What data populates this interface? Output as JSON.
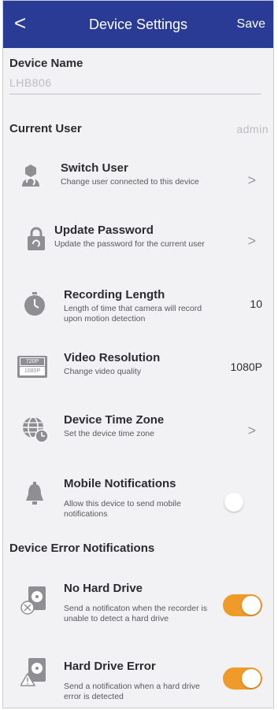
{
  "header": {
    "back_label": "<",
    "title": "Device Settings",
    "save_label": "Save",
    "bg_color": "#2a3b95"
  },
  "device_name": {
    "label": "Device Name",
    "value": "LHB806"
  },
  "current_user": {
    "label": "Current User",
    "value": "admin"
  },
  "items": [
    {
      "title": "Switch User",
      "desc": "Change user connected to this device",
      "icon": "user-switch-icon",
      "trailing": ">"
    },
    {
      "title": "Update Password",
      "desc": "Update the password for the current user",
      "icon": "lock-refresh-icon",
      "trailing": ">"
    },
    {
      "title": "Recording Length",
      "desc": "Length of time that camera will record upon motion detection",
      "icon": "stopwatch-icon",
      "trailing": "10"
    },
    {
      "title": "Video Resolution",
      "desc": "Change video quality",
      "icon": "resolution-icon",
      "trailing": "1080P",
      "icon_text_top": "720P",
      "icon_text_bottom": "1080P"
    },
    {
      "title": "Device Time Zone",
      "desc": "Set the device time zone",
      "icon": "globe-clock-icon",
      "trailing": ">"
    },
    {
      "title": "Mobile Notifications",
      "desc": "Allow this device to send mobile notifications",
      "icon": "bell-icon",
      "toggle": false
    }
  ],
  "error_section": {
    "label": "Device Error Notifications",
    "items": [
      {
        "title": "No Hard Drive",
        "desc": "Send a notificaton when the recorder is unable to detect a hard drive",
        "icon": "hard-drive-x-icon",
        "toggle": true
      },
      {
        "title": "Hard Drive Error",
        "desc": "Send a notification when a hard drive error is detected",
        "icon": "hard-drive-warning-icon",
        "toggle": true
      }
    ]
  },
  "colors": {
    "accent_orange": "#f09a2a",
    "icon_gray": "#8e8e93"
  }
}
